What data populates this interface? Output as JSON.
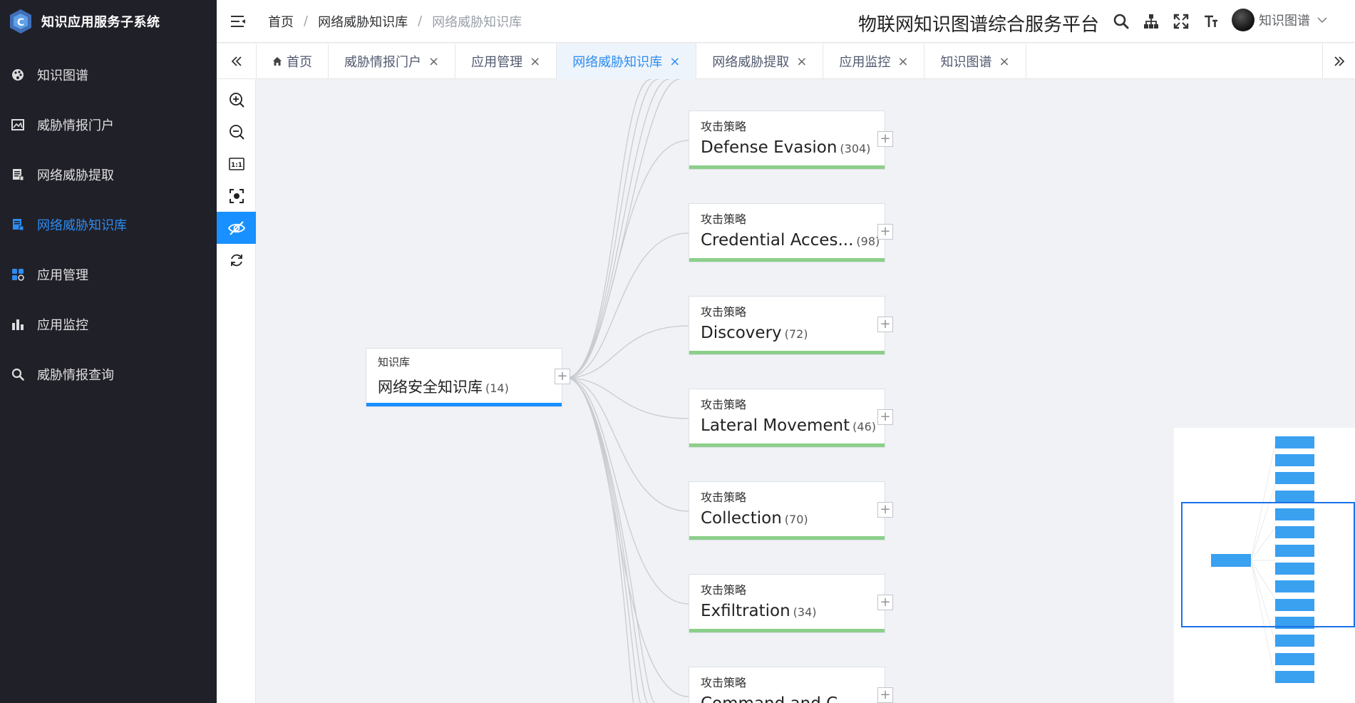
{
  "brand": {
    "title": "知识应用服务子系统"
  },
  "sidebar": {
    "items": [
      {
        "label": "知识图谱",
        "icon": "palette-icon",
        "active": false
      },
      {
        "label": "威胁情报门户",
        "icon": "image-icon",
        "active": false
      },
      {
        "label": "网络威胁提取",
        "icon": "document-icon",
        "active": false
      },
      {
        "label": "网络威胁知识库",
        "icon": "database-icon",
        "active": true
      },
      {
        "label": "应用管理",
        "icon": "grid-icon",
        "active": false
      },
      {
        "label": "应用监控",
        "icon": "bar-chart-icon",
        "active": false
      },
      {
        "label": "威胁情报查询",
        "icon": "search-icon",
        "active": false
      }
    ]
  },
  "header": {
    "breadcrumb": [
      "首页",
      "网络威胁知识库",
      "网络威胁知识库"
    ],
    "platform_title": "物联网知识图谱综合服务平台",
    "user_name": "知识图谱"
  },
  "tabs": [
    {
      "label": "首页",
      "closable": false,
      "active": false
    },
    {
      "label": "威胁情报门户",
      "closable": true,
      "active": false
    },
    {
      "label": "应用管理",
      "closable": true,
      "active": false
    },
    {
      "label": "网络威胁知识库",
      "closable": true,
      "active": true
    },
    {
      "label": "网络威胁提取",
      "closable": true,
      "active": false
    },
    {
      "label": "应用监控",
      "closable": true,
      "active": false
    },
    {
      "label": "知识图谱",
      "closable": true,
      "active": false
    }
  ],
  "tab_close_glyph": "×",
  "graph": {
    "root": {
      "type": "知识库",
      "name": "网络安全知识库",
      "count": "(14)"
    },
    "nodes": [
      {
        "type": "攻击策略",
        "name": "Defense Evasion",
        "count": "(304)"
      },
      {
        "type": "攻击策略",
        "name": "Credential Acces...",
        "count": "(98)"
      },
      {
        "type": "攻击策略",
        "name": "Discovery",
        "count": "(72)"
      },
      {
        "type": "攻击策略",
        "name": "Lateral Movement",
        "count": "(46)"
      },
      {
        "type": "攻击策略",
        "name": "Collection",
        "count": "(70)"
      },
      {
        "type": "攻击策略",
        "name": "Exfiltration",
        "count": "(34)"
      },
      {
        "type": "攻击策略",
        "name": "Command and C...",
        "count": ""
      }
    ],
    "expand_glyph": "+"
  },
  "colors": {
    "sidebar_bg": "#202029",
    "accent": "#1890ff",
    "node_bar": "#8ccf8a"
  }
}
